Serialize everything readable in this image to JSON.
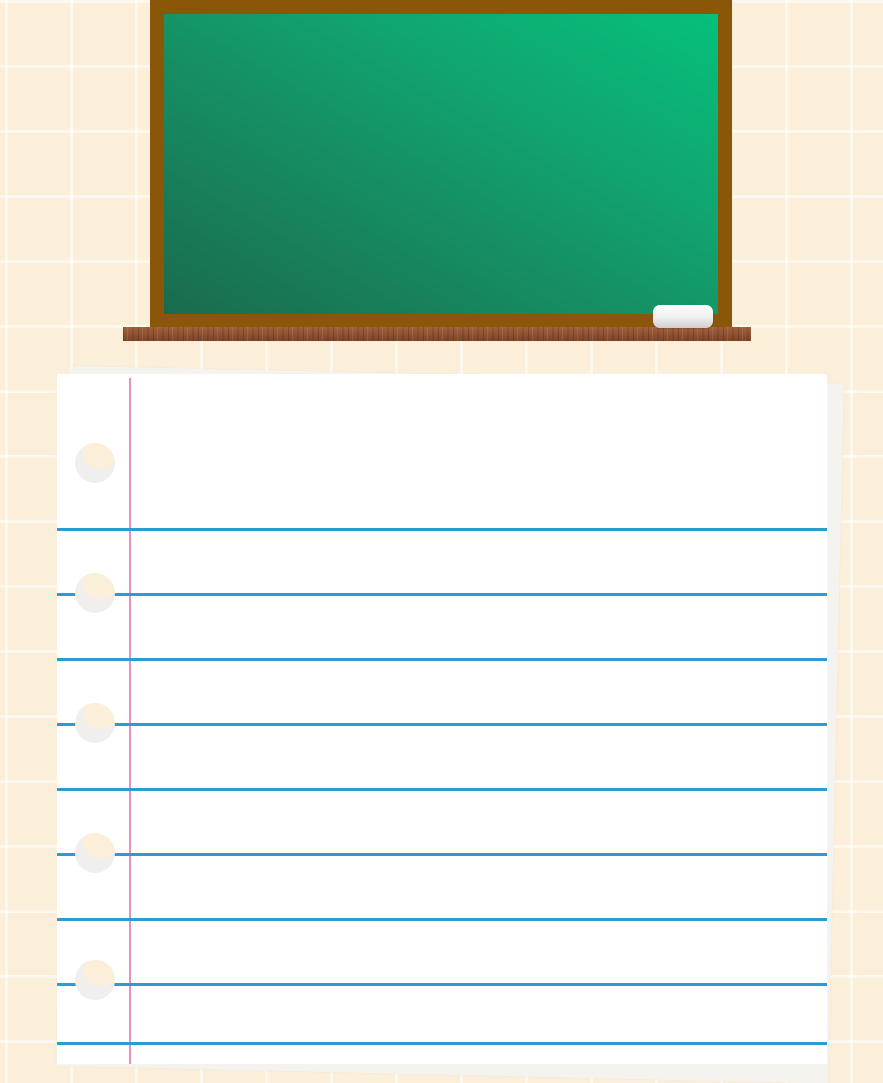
{
  "scene": {
    "background_color": "#fbefda",
    "chalkboard": {
      "frame_color": "#8a5608",
      "surface_colors": [
        "#1a6b4e",
        "#05c07b"
      ],
      "chalk_color": "#ffffff",
      "ledge_color": "#8b4e2e"
    },
    "notebook_page": {
      "paper_color": "#ffffff",
      "rule_color": "#2b9bd2",
      "margin_color": "#e58fc6",
      "punch_hole_count": 5,
      "ruled_line_count": 9
    }
  }
}
